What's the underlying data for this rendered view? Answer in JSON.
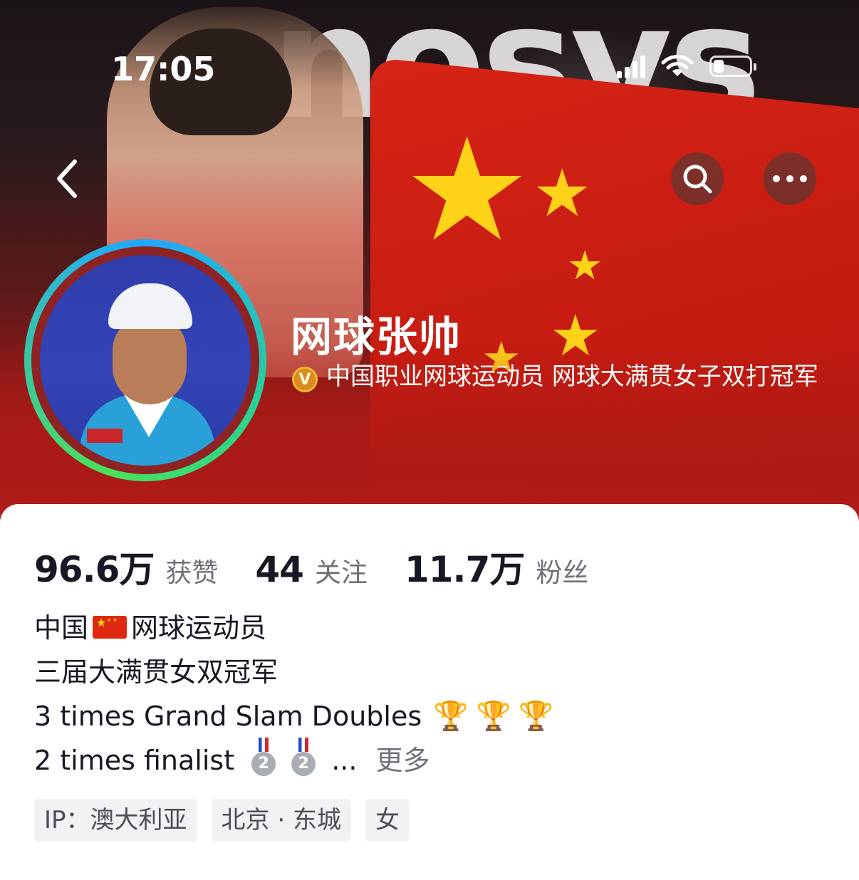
{
  "status_bar": {
    "time": "17:05"
  },
  "hero": {
    "background_text": "nosys"
  },
  "icons": {
    "back": "chevron-left-icon",
    "search": "search-icon",
    "more": "more-horizontal-icon",
    "verified": "verified-v-icon"
  },
  "profile": {
    "name": "网球张帅",
    "verified_badge": "V",
    "verified_text": "中国职业网球运动员  网球大满贯女子双打冠军"
  },
  "stats": [
    {
      "value": "96.6万",
      "label": "获赞"
    },
    {
      "value": "44",
      "label": "关注"
    },
    {
      "value": "11.7万",
      "label": "粉丝"
    }
  ],
  "bio": {
    "line1_a": "中国",
    "line1_b": "网球运动员",
    "line2": "三届大满贯女双冠军",
    "line3": "3 times Grand Slam Doubles",
    "line4": "2 times finalist",
    "medal_text": "2",
    "ellipsis": "...",
    "more": "更多"
  },
  "tags": [
    "IP：澳大利亚",
    "北京 · 东城",
    "女"
  ],
  "colors": {
    "hero_red": "#b01c17",
    "text_primary": "#161823",
    "text_secondary": "#6f7078",
    "tag_bg": "#f2f2f4"
  }
}
